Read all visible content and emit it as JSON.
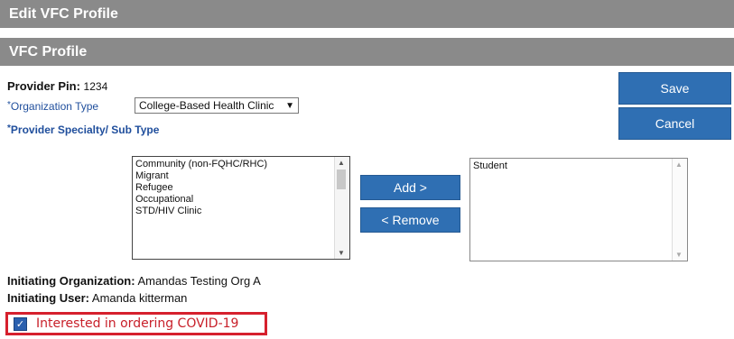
{
  "header": {
    "title": "Edit VFC Profile",
    "section": "VFC Profile"
  },
  "provider_pin": {
    "label": "Provider Pin:",
    "value": "1234"
  },
  "org_type": {
    "required": "*",
    "label": "Organization Type",
    "value": "College-Based Health Clinic"
  },
  "specialty": {
    "required": "*",
    "label": "Provider Specialty/ Sub Type"
  },
  "available_list": [
    "Community (non-FQHC/RHC)",
    "Migrant",
    "Refugee",
    "Occupational",
    "STD/HIV Clinic"
  ],
  "selected_list": [
    "Student"
  ],
  "buttons": {
    "save": "Save",
    "cancel": "Cancel",
    "add": "Add >",
    "remove": "< Remove"
  },
  "initiating_org": {
    "label": "Initiating Organization:",
    "value": "Amandas Testing Org A"
  },
  "initiating_user": {
    "label": "Initiating User:",
    "value": "Amanda kitterman"
  },
  "covid": {
    "label": "Interested in ordering COVID-19",
    "checked": true
  },
  "colors": {
    "header_bg": "#8a8a8a",
    "button_bg": "#2f6fb3",
    "label_blue": "#1f4e9c",
    "highlight_red": "#d6202d"
  }
}
